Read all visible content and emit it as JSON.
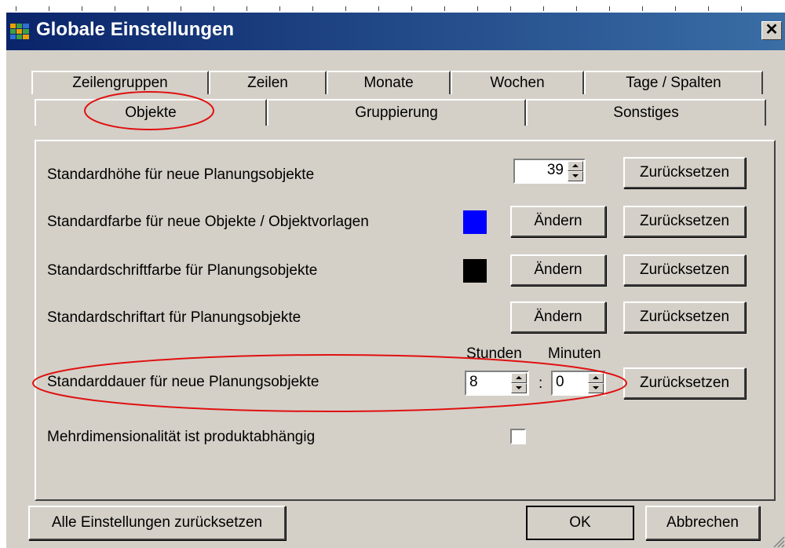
{
  "window": {
    "title": "Globale Einstellungen",
    "close_label": "✕"
  },
  "tabs_back": [
    "Zeilengruppen",
    "Zeilen",
    "Monate",
    "Wochen",
    "Tage / Spalten"
  ],
  "tabs_front": [
    "Objekte",
    "Gruppierung",
    "Sonstiges"
  ],
  "active_tab": "Objekte",
  "settings": {
    "height": {
      "label": "Standardhöhe für neue Planungsobjekte",
      "value": "39",
      "reset_label": "Zurücksetzen"
    },
    "color": {
      "label": "Standardfarbe für neue Objekte / Objektvorlagen",
      "swatch": "#0000ff",
      "change_label": "Ändern",
      "reset_label": "Zurücksetzen"
    },
    "font_color": {
      "label": "Standardschriftfarbe für Planungsobjekte",
      "swatch": "#000000",
      "change_label": "Ändern",
      "reset_label": "Zurücksetzen"
    },
    "font": {
      "label": "Standardschriftart für Planungsobjekte",
      "change_label": "Ändern",
      "reset_label": "Zurücksetzen"
    },
    "duration": {
      "label": "Standarddauer für neue Planungsobjekte",
      "hours_header": "Stunden",
      "minutes_header": "Minuten",
      "hours": "8",
      "separator": ":",
      "minutes": "0",
      "reset_label": "Zurücksetzen"
    },
    "multidim": {
      "label": "Mehrdimensionalität ist produktabhängig",
      "checked": false
    }
  },
  "footer": {
    "reset_all_label": "Alle Einstellungen zurücksetzen",
    "ok_label": "OK",
    "cancel_label": "Abbrechen"
  },
  "colors": {
    "titlebar_start": "#0a246a",
    "titlebar_end": "#3a6ea5",
    "face": "#d4d0c8",
    "annotation": "#e01010"
  }
}
